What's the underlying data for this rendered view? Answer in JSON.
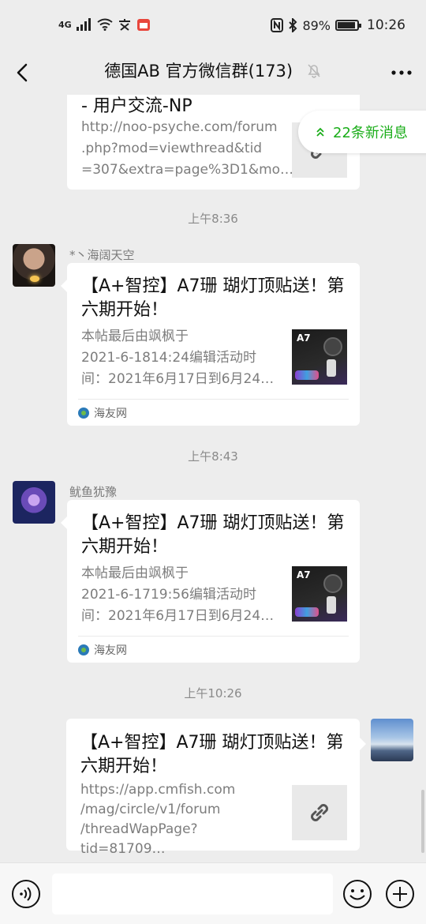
{
  "status_bar": {
    "network": "4G",
    "battery": "89%",
    "time": "10:26"
  },
  "header": {
    "title": "德国AB  官方微信群(173)",
    "icons": [
      "back-icon",
      "mute-icon",
      "more-icon"
    ]
  },
  "new_messages": "22条新消息",
  "messages": [
    {
      "type": "link_card_partial",
      "title_tail": "- 用户交流-NP",
      "desc": "http://noo-psyche.com/forum.php?mod=viewthread&tid=307&extra=page%3D1&mo…",
      "desc_lines": [
        "http://noo-psyche.com/forum",
        ".php?mod=viewthread&tid",
        "=307&extra=page%3D1&mo…"
      ]
    },
    {
      "time": "上午8:36",
      "sender": "*丶海阔天空",
      "title_lines": [
        "【A+智控】A7珊 瑚灯顶贴送！第",
        "六期开始！"
      ],
      "desc_lines": [
        "本帖最后由飒枫于",
        "2021-6-1814:24编辑活动时",
        "间：2021年6月17日到6月24…"
      ],
      "thumb_text": "A7",
      "source": "海友网"
    },
    {
      "time": "上午8:43",
      "sender": "鱿鱼犹豫",
      "title_lines": [
        "【A+智控】A7珊 瑚灯顶贴送！第",
        "六期开始！"
      ],
      "desc_lines": [
        "本帖最后由飒枫于",
        "2021-6-1719:56编辑活动时",
        "间：2021年6月17日到6月24…"
      ],
      "thumb_text": "A7",
      "source": "海友网"
    },
    {
      "time": "上午10:26",
      "sender": "",
      "title_lines": [
        "【A+智控】A7珊 瑚灯顶贴送！第",
        "六期开始！"
      ],
      "desc_lines": [
        "https://app.cmfish.com",
        "/mag/circle/v1/forum",
        "/threadWapPage?tid=81709…"
      ]
    }
  ],
  "colors": {
    "background": "#ededed",
    "card": "#ffffff",
    "accent_green": "#1aad19",
    "muted_text": "#7d7d7d"
  }
}
